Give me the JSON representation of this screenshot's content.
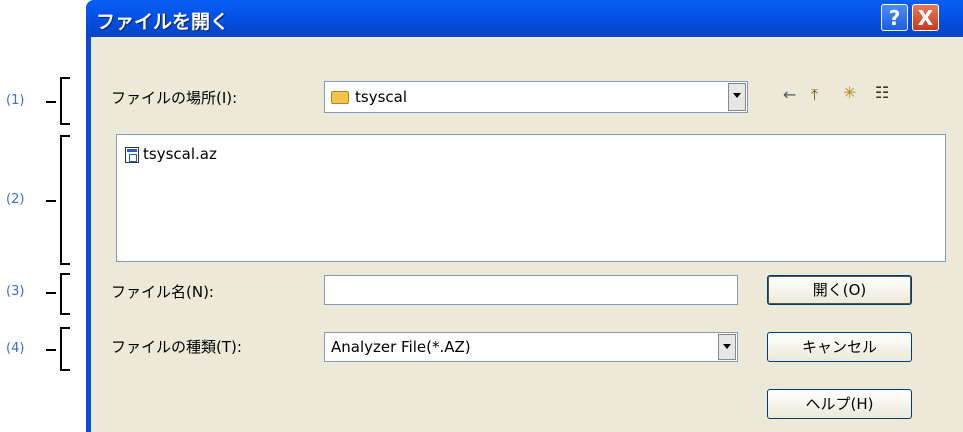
{
  "callouts": [
    "(1)",
    "(2)",
    "(3)",
    "(4)"
  ],
  "window": {
    "title": "ファイルを開く",
    "help_glyph": "?",
    "close_glyph": "X"
  },
  "look_in": {
    "label": "ファイルの場所(I):",
    "value": "tsyscal"
  },
  "toolbar": {
    "back_icon": "←",
    "up_icon": "⤒",
    "new_folder_icon": "✳",
    "view_icon": "☷"
  },
  "files": [
    {
      "name": "tsyscal.az"
    }
  ],
  "filename": {
    "label": "ファイル名(N):",
    "value": ""
  },
  "filetype": {
    "label": "ファイルの種類(T):",
    "value": "Analyzer File(*.AZ)"
  },
  "buttons": {
    "open": "開く(O)",
    "cancel": "キャンセル",
    "help": "ヘルプ(H)"
  }
}
